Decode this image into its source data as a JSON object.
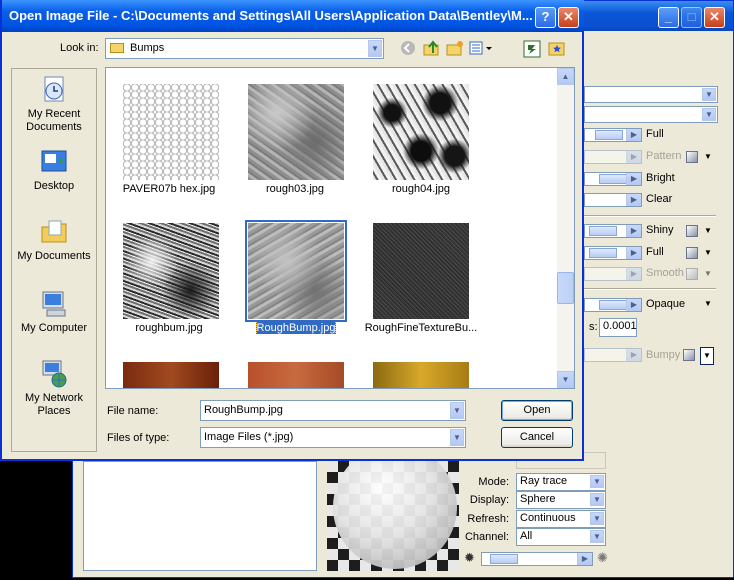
{
  "dialog": {
    "title": "Open Image File - C:\\Documents and Settings\\All Users\\Application Data\\Bentley\\M...",
    "help_label": "?",
    "close_label": "✕",
    "look_in_label": "Look in:",
    "look_in_value": "Bumps",
    "places": [
      {
        "label": "My Recent Documents"
      },
      {
        "label": "Desktop"
      },
      {
        "label": "My Documents"
      },
      {
        "label": "My Computer"
      },
      {
        "label": "My Network Places"
      }
    ],
    "files": [
      {
        "name": "PAVER07b hex.jpg"
      },
      {
        "name": "rough03.jpg"
      },
      {
        "name": "rough04.jpg"
      },
      {
        "name": "roughbum.jpg"
      },
      {
        "name": "RoughBump.jpg"
      },
      {
        "name": "RoughFineTextureBu..."
      }
    ],
    "file_name_label": "File name:",
    "file_name_value": "RoughBump.jpg",
    "files_of_type_label": "Files of type:",
    "files_of_type_value": "Image Files (*.jpg)",
    "open_label": "Open",
    "cancel_label": "Cancel"
  },
  "background_panel": {
    "title_buttons": {
      "minimize": "_",
      "maximize": "□",
      "close": "✕"
    },
    "rows": [
      {
        "label": "Full"
      },
      {
        "label": "Pattern"
      },
      {
        "label": "Bright"
      },
      {
        "label": "Clear"
      },
      {
        "label": "Shiny"
      },
      {
        "label": "Full"
      },
      {
        "label": "Smooth"
      },
      {
        "label": "Opaque"
      },
      {
        "label": "Bumpy"
      }
    ],
    "field_suffix": "s:",
    "field_value": "0.0001",
    "preview": {
      "mode_label": "Mode:",
      "mode_value": "Ray trace",
      "display_label": "Display:",
      "display_value": "Sphere",
      "refresh_label": "Refresh:",
      "refresh_value": "Continuous",
      "channel_label": "Channel:",
      "channel_value": "All"
    }
  }
}
